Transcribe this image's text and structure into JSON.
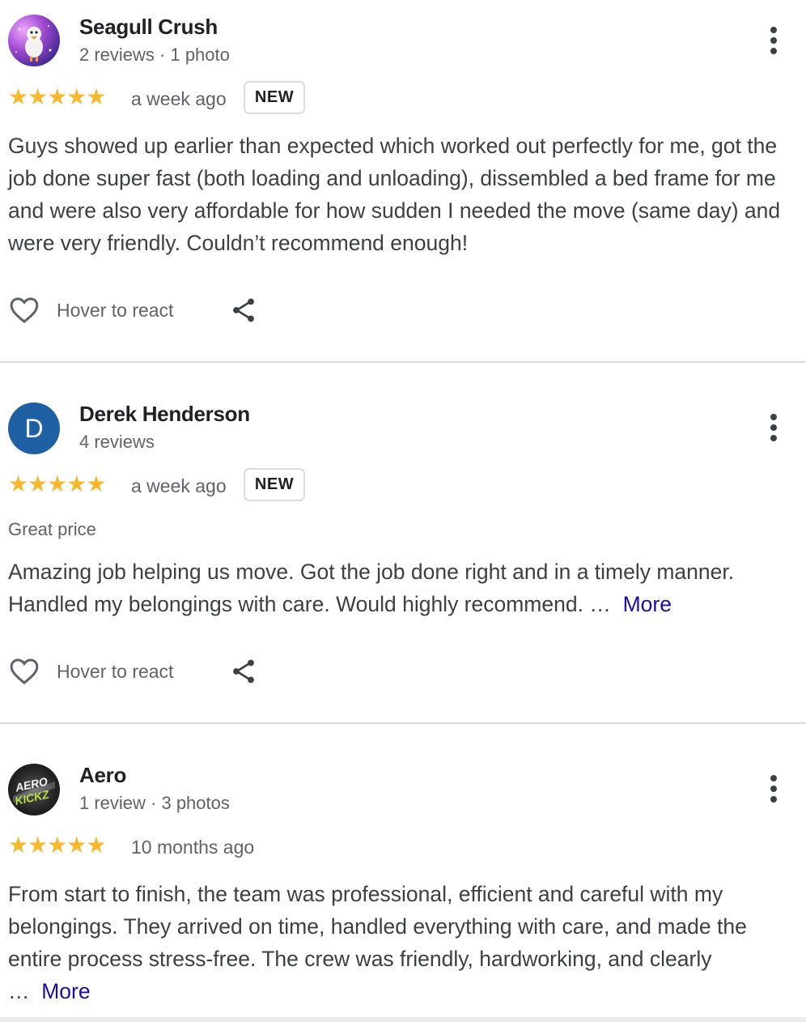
{
  "reviews": [
    {
      "name": "Seagull Crush",
      "meta": "2 reviews · 1 photo",
      "stars": "★★★★★",
      "rating": 5,
      "time": "a week ago",
      "badge": "NEW",
      "body": "Guys showed up earlier than expected which worked out perfectly for me, got the job done super fast (both loading and unloading), dissembled a bed frame for me and were also very affordable for how sudden I needed the move (same day) and were very friendly. Couldn’t recommend enough!",
      "react_label": "Hover to react"
    },
    {
      "name": "Derek Henderson",
      "avatar_letter": "D",
      "meta": "4 reviews",
      "stars": "★★★★★",
      "rating": 5,
      "time": "a week ago",
      "badge": "NEW",
      "label": "Great price",
      "body": "Amazing job helping us move. Got the job done right and in a timely manner. Handled my belongings with care. Would highly recommend. …",
      "more": "More",
      "react_label": "Hover to react"
    },
    {
      "name": "Aero",
      "avatar_text": "AERO KICKZ",
      "meta": "1 review · 3 photos",
      "stars": "★★★★★",
      "rating": 5,
      "time": "10 months ago",
      "body": "From start to finish, the team was professional, efficient and careful with my belongings. They arrived on time, handled everything with care, and made the entire process stress-free. The crew was friendly, hardworking, and clearly …",
      "more": "More"
    }
  ],
  "colors": {
    "star": "#f5b82e",
    "link": "#1a0dab",
    "avatar_d": "#1f5fa3"
  }
}
